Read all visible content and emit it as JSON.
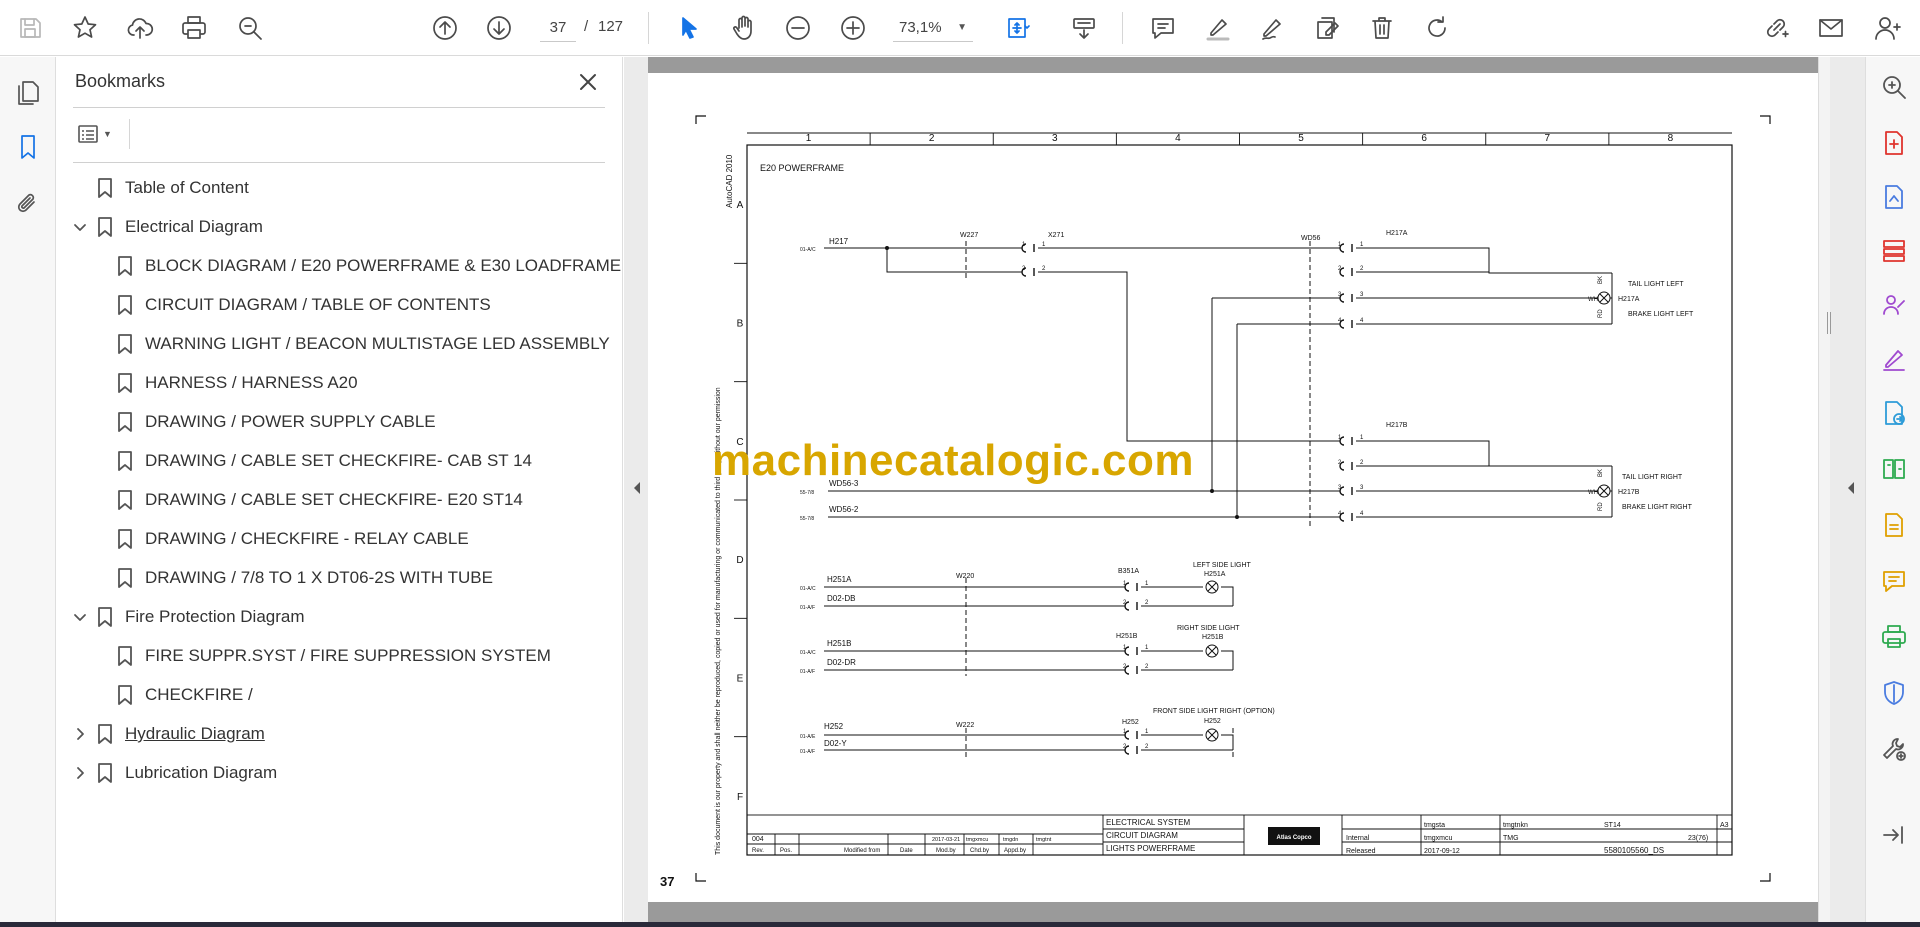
{
  "toolbar": {
    "page_current": "37",
    "page_separator": "/",
    "page_total": "127",
    "zoom": "73,1%",
    "icons": [
      "save-icon",
      "bookmark-star-icon",
      "cloud-upload-icon",
      "print-icon",
      "search-icon",
      "prev-page-icon",
      "next-page-icon",
      "select-arrow-icon",
      "hand-tool-icon",
      "zoom-out-icon",
      "zoom-in-icon",
      "fit-page-icon",
      "scroll-mode-icon",
      "comment-icon",
      "highlight-pen-icon",
      "sign-pen-icon",
      "edit-stamp-icon",
      "trash-icon",
      "rotate-icon",
      "link-share-icon",
      "email-icon",
      "account-icon"
    ]
  },
  "left_rail": {
    "icons": [
      "pages-icon",
      "bookmarks-icon",
      "attachments-icon"
    ]
  },
  "bookmarks": {
    "title": "Bookmarks",
    "items": [
      {
        "label": "Table of Content",
        "level": 0,
        "expand": "none"
      },
      {
        "label": "Electrical Diagram",
        "level": 0,
        "expand": "open"
      },
      {
        "label": "BLOCK DIAGRAM / E20 POWERFRAME & E30 LOADFRAME",
        "level": 1,
        "expand": "none"
      },
      {
        "label": "CIRCUIT DIAGRAM / TABLE OF CONTENTS",
        "level": 1,
        "expand": "none"
      },
      {
        "label": "WARNING LIGHT / BEACON MULTISTAGE LED ASSEMBLY",
        "level": 1,
        "expand": "none"
      },
      {
        "label": "HARNESS / HARNESS A20",
        "level": 1,
        "expand": "none"
      },
      {
        "label": "DRAWING / POWER SUPPLY CABLE",
        "level": 1,
        "expand": "none"
      },
      {
        "label": "DRAWING / CABLE SET CHECKFIRE- CAB ST 14",
        "level": 1,
        "expand": "none"
      },
      {
        "label": "DRAWING / CABLE SET CHECKFIRE- E20 ST14",
        "level": 1,
        "expand": "none"
      },
      {
        "label": "DRAWING / CHECKFIRE - RELAY CABLE",
        "level": 1,
        "expand": "none"
      },
      {
        "label": "DRAWING / 7/8 TO 1 X DT06-2S WITH TUBE",
        "level": 1,
        "expand": "none"
      },
      {
        "label": "Fire Protection Diagram",
        "level": 0,
        "expand": "open"
      },
      {
        "label": "FIRE SUPPR.SYST / FIRE SUPPRESSION SYSTEM",
        "level": 1,
        "expand": "none"
      },
      {
        "label": "CHECKFIRE /",
        "level": 1,
        "expand": "none"
      },
      {
        "label": "Hydraulic Diagram",
        "level": 0,
        "expand": "closed",
        "underline": true
      },
      {
        "label": "Lubrication Diagram",
        "level": 0,
        "expand": "closed"
      }
    ]
  },
  "right_rail": {
    "icons": [
      {
        "name": "zoom-icon",
        "color": "#555555"
      },
      {
        "name": "export-pdf-icon",
        "color": "#e0342e"
      },
      {
        "name": "create-pdf-icon",
        "color": "#4a7ce0"
      },
      {
        "name": "organize-pages-icon",
        "color": "#e0342e"
      },
      {
        "name": "request-signatures-icon",
        "color": "#a04ad0"
      },
      {
        "name": "fill-sign-icon",
        "color": "#a04ad0"
      },
      {
        "name": "send-file-icon",
        "color": "#2e9cd8"
      },
      {
        "name": "compare-files-icon",
        "color": "#2eaa50"
      },
      {
        "name": "export-file-icon",
        "color": "#e0a000"
      },
      {
        "name": "comment-tool-icon",
        "color": "#e0a000"
      },
      {
        "name": "print-production-icon",
        "color": "#2eaa50"
      },
      {
        "name": "protect-icon",
        "color": "#4a7ce0"
      },
      {
        "name": "more-tools-icon",
        "color": "#555555"
      },
      {
        "name": "collapse-panel-icon",
        "color": "#555555"
      }
    ]
  },
  "document": {
    "page_number": "37",
    "watermark": "machinecatalogic.com",
    "drawing": {
      "columns": [
        "1",
        "2",
        "3",
        "4",
        "5",
        "6",
        "7",
        "8"
      ],
      "rows": [
        "A",
        "B",
        "C",
        "D",
        "E",
        "F"
      ],
      "vertical_note": "AutoCAD 2010",
      "legal_note": "This document is our property and shall neither be reproduced, copied or used for manufacturing or communicated to third party without our permission",
      "title": "E20 POWERFRAME",
      "labels": {
        "h217": "H217",
        "ref_h217": "01-A/C",
        "w227": "W227",
        "x271": "X271",
        "wd56": "WD56",
        "h217a": "H217A",
        "h217b": "H217B",
        "tail_left": "TAIL LIGHT LEFT",
        "brake_left": "BRAKE LIGHT LEFT",
        "tail_right": "TAIL LIGHT RIGHT",
        "brake_right": "BRAKE LIGHT RIGHT",
        "h217a_lamp": "H217A",
        "h217b_lamp": "H217B",
        "bk": "BK",
        "wh": "WH",
        "rd": "RD",
        "wd56_3": "WD56-3",
        "wd56_2": "WD56-2",
        "ref_wd56_3": "55-7/8",
        "ref_wd56_2": "55-7/8",
        "h251a": "H251A",
        "d02_db": "D02-DB",
        "ref_h251a": "01-A/C",
        "ref_d02db": "01-A/F",
        "w220": "W220",
        "b351a": "B351A",
        "left_side": "LEFT SIDE LIGHT",
        "h251a_lamp": "H251A",
        "h251b": "H251B",
        "d02_dr": "D02-DR",
        "ref_h251b": "01-A/C",
        "ref_d02dr": "01-A/F",
        "h251b_conn": "H251B",
        "right_side": "RIGHT SIDE LIGHT",
        "h251b_lamp": "H251B",
        "h252": "H252",
        "d02_y": "D02-Y",
        "ref_h252": "01-A/E",
        "ref_d02y": "01-A/F",
        "w222": "W222",
        "h252_conn": "H252",
        "front_side": "FRONT SIDE LIGHT RIGHT (OPTION)",
        "h252_lamp": "H252",
        "pin1": "1",
        "pin2": "2",
        "pin3": "3",
        "pin4": "4"
      },
      "title_block": {
        "rev_no": "004",
        "rev_date": "2017-03-21",
        "rev_mod": "tmgxmcu",
        "rev_chk": "tmgdn",
        "rev_app": "tmgtnt",
        "rev_header": [
          "Rev.",
          "Pos.",
          "Modified from",
          "Date",
          "Mod.by",
          "Chd.by",
          "Appd.by"
        ],
        "system_lines": [
          "ELECTRICAL SYSTEM",
          "CIRCUIT DIAGRAM",
          "LIGHTS POWERFRAME"
        ],
        "logo": "Atlas Copco",
        "conf": "Internal",
        "status": "Released",
        "drawn": "tmgsta",
        "design_resp": "tmgxmcu",
        "date": "2017-09-12",
        "approved": "tmgtnkn",
        "drawing_owner": "TMG",
        "sheet_size": "A3",
        "series": "ST14",
        "sheet": "23(76)",
        "doc_no": "5580105560_DS"
      }
    }
  }
}
